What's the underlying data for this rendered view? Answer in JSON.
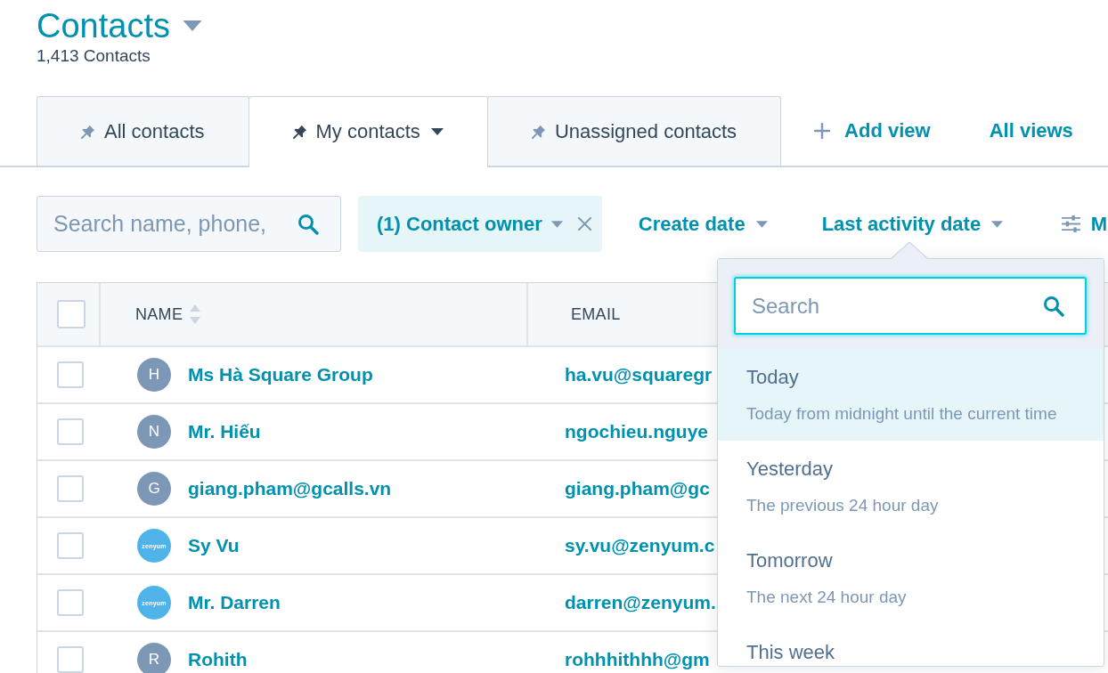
{
  "header": {
    "title": "Contacts",
    "count": "1,413 Contacts"
  },
  "tabs": [
    {
      "label": "All contacts",
      "selected": false,
      "menu": false
    },
    {
      "label": "My contacts",
      "selected": true,
      "menu": true
    },
    {
      "label": "Unassigned contacts",
      "selected": false,
      "menu": false
    }
  ],
  "view_actions": [
    {
      "kind": "add",
      "label": "Add view"
    },
    {
      "kind": "link",
      "label": "All views"
    }
  ],
  "search": {
    "placeholder": "Search name, phone,"
  },
  "filters": [
    {
      "kind": "chip",
      "label": "(1) Contact owner"
    },
    {
      "kind": "dropdown",
      "label": "Create date"
    },
    {
      "kind": "dropdown",
      "label": "Last activity date"
    },
    {
      "kind": "more",
      "label": "M"
    }
  ],
  "table": {
    "select_all": {
      "checked": false
    },
    "columns": [
      {
        "label": "NAME",
        "sortable": true
      },
      {
        "label": "EMAIL",
        "sortable": false
      }
    ],
    "rows": [
      {
        "checked": false,
        "avatar": {
          "kind": "initial",
          "text": "H"
        },
        "name": "Ms Hà Square Group",
        "email": "ha.vu@squaregr"
      },
      {
        "checked": false,
        "avatar": {
          "kind": "initial",
          "text": "N"
        },
        "name": "Mr. Hiếu",
        "email": "ngochieu.nguye"
      },
      {
        "checked": false,
        "avatar": {
          "kind": "initial",
          "text": "G"
        },
        "name": "giang.pham@gcalls.vn",
        "email": "giang.pham@gc"
      },
      {
        "checked": false,
        "avatar": {
          "kind": "logo",
          "text": "zenyum"
        },
        "name": "Sy Vu",
        "email": "sy.vu@zenyum.c"
      },
      {
        "checked": false,
        "avatar": {
          "kind": "logo",
          "text": "zenyum"
        },
        "name": "Mr. Darren",
        "email": "darren@zenyum."
      },
      {
        "checked": false,
        "avatar": {
          "kind": "initial",
          "text": "R"
        },
        "name": "Rohith",
        "email": "rohhhithhh@gm"
      }
    ]
  },
  "date_menu": {
    "search": {
      "placeholder": "Search"
    },
    "options": [
      {
        "label": "Today",
        "description": "Today from midnight until the current time",
        "selected": true
      },
      {
        "label": "Yesterday",
        "description": "The previous 24 hour day",
        "selected": false
      },
      {
        "label": "Tomorrow",
        "description": "The next 24 hour day",
        "selected": false
      },
      {
        "label": "This week",
        "selected": false
      }
    ]
  }
}
